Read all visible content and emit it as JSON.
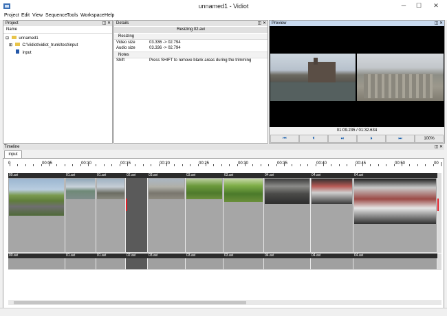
{
  "window": {
    "title": "unnamed1 - Vidiot",
    "minimize": "─",
    "maximize": "☐",
    "close": "✕"
  },
  "menu": [
    "Project",
    "Edit",
    "View",
    "Sequence",
    "Tools",
    "Workspace",
    "Help"
  ],
  "project_panel": {
    "title": "Project",
    "column": "Name",
    "items": [
      {
        "label": "unnamed1",
        "expander": "⊟"
      },
      {
        "label": "C:\\Vidiot\\vidiot_trunk\\test\\input",
        "expander": "⊞"
      },
      {
        "label": "input",
        "expander": ""
      }
    ]
  },
  "details_panel": {
    "title": "Details",
    "header": "Resizing 02.avi",
    "section_resizing": "Resizing",
    "rows": [
      {
        "label": "Video size",
        "value": "03.336 -> 02.794"
      },
      {
        "label": "Audio size",
        "value": "03.336 -> 02.794"
      }
    ],
    "section_notes": "Notes",
    "shift_label": "Shift",
    "shift_value": "Press SHIFT to remove blank areas during the trimming"
  },
  "preview_panel": {
    "title": "Preview",
    "time": "01:09.235 / 01:32.634",
    "zoom": "100%",
    "buttons": [
      "⏮",
      "⏴",
      "⏯",
      "⏵",
      "⏭"
    ]
  },
  "timeline_panel": {
    "title": "Timeline",
    "tab": "input",
    "ruler": [
      "0",
      "00:05",
      "00:10",
      "00:15",
      "00:20",
      "00:25",
      "00:30",
      "00:35",
      "00:40",
      "00:45",
      "00:50",
      "00"
    ],
    "video_clips": [
      "00.avi",
      "01.avi",
      "01.avi",
      "02.avi",
      "03.avi",
      "03.avi",
      "03.avi",
      "04.avi",
      "04.avi",
      "04.avi"
    ],
    "audio_clips": [
      "00.avi",
      "01.avi",
      "01.avi",
      "02.avi",
      "03.avi",
      "03.avi",
      "03.avi",
      "04.avi",
      "04.avi",
      "04.avi"
    ]
  },
  "colors": {
    "panel_header": "#e3e3e3",
    "preview_header": "#c9daf0",
    "clip_header": "#2c2c2c",
    "clip_body": "#a6a6a6",
    "selected_clip": "#5a5a5a",
    "trim_marker": "#e0202a"
  },
  "icons": [
    "app-icon",
    "folder-icon",
    "sequence-icon",
    "skip-start-icon",
    "step-back-icon",
    "play-pause-icon",
    "step-forward-icon",
    "skip-end-icon"
  ]
}
